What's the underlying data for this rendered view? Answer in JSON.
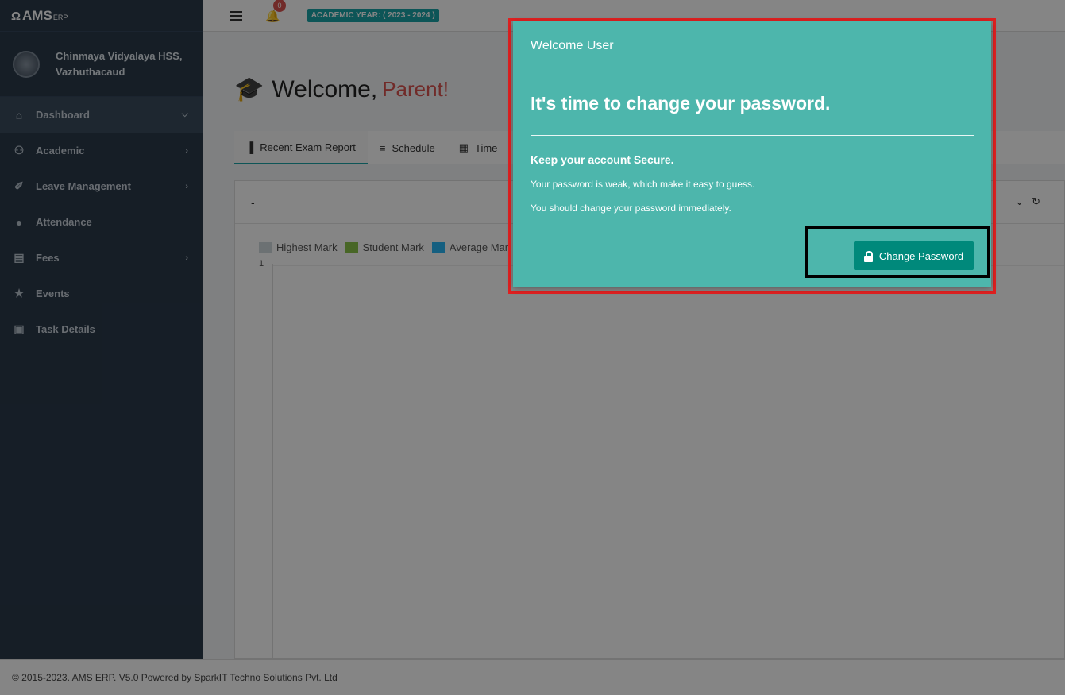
{
  "brand": {
    "name": "AMS",
    "suffix": "ERP"
  },
  "school": {
    "line1": "Chinmaya Vidyalaya HSS,",
    "line2": "Vazhuthacaud"
  },
  "sidebar": {
    "items": [
      {
        "label": "Dashboard",
        "icon": "home-icon"
      },
      {
        "label": "Academic",
        "icon": "users-icon"
      },
      {
        "label": "Leave Management",
        "icon": "paperclip-icon"
      },
      {
        "label": "Attendance",
        "icon": "user-icon"
      },
      {
        "label": "Fees",
        "icon": "money-icon"
      },
      {
        "label": "Events",
        "icon": "star-icon"
      },
      {
        "label": "Task Details",
        "icon": "list-icon"
      }
    ]
  },
  "topbar": {
    "notifications": "0",
    "academic_year": "ACADEMIC YEAR: ( 2023 - 2024 )"
  },
  "welcome": {
    "greeting": "Welcome,",
    "role": "Parent!"
  },
  "tabs": [
    {
      "label": "Recent Exam Report",
      "icon": "bar-chart-icon"
    },
    {
      "label": "Schedule",
      "icon": "list-lines-icon"
    },
    {
      "label": "Time",
      "icon": "calendar-icon"
    }
  ],
  "panel": {
    "title": "-",
    "y_tick": "1"
  },
  "legend": [
    {
      "label": "Highest Mark",
      "color": "#cfd8dc"
    },
    {
      "label": "Student Mark",
      "color": "#8bc34a"
    },
    {
      "label": "Average Mar",
      "color": "#29b6f6"
    }
  ],
  "modal": {
    "title": "Welcome User",
    "heading": "It's time to change your password.",
    "subheading": "Keep your account Secure.",
    "line1": "Your password is weak, which make it easy to guess.",
    "line2": "You should change your password immediately.",
    "button_label": "Change Password"
  },
  "footer": {
    "text": "© 2015-2023. AMS ERP. V5.0 Powered by SparkIT Techno Solutions Pvt. Ltd"
  },
  "colors": {
    "accent": "#1aa3a8",
    "modal_bg": "#4db6ac",
    "button_bg": "#00897b",
    "highlight_red": "#e02020"
  }
}
